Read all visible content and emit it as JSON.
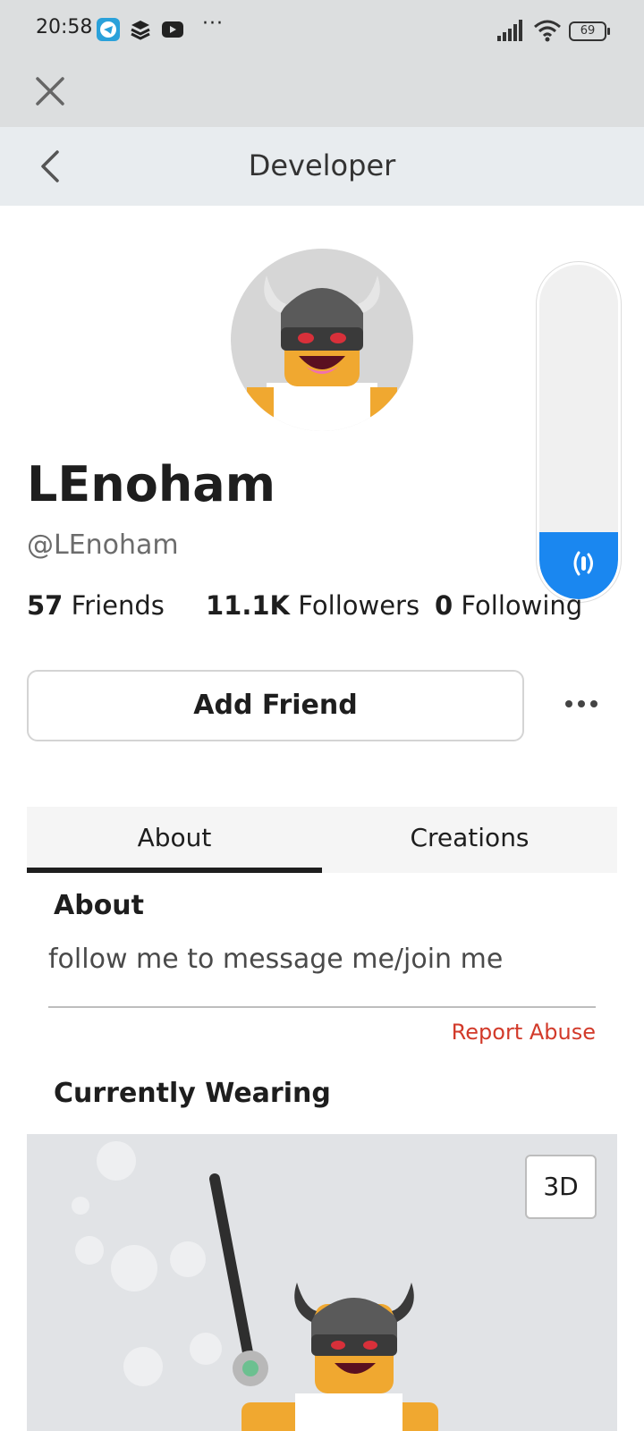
{
  "status_bar": {
    "time": "20:58",
    "battery": "69",
    "app_icons": [
      "telegram-icon",
      "layers-app-icon",
      "youtube-icon"
    ],
    "more": "···"
  },
  "webview": {
    "close_icon": "close-icon"
  },
  "nav": {
    "title": "Developer",
    "back_icon": "chevron-left-icon"
  },
  "profile": {
    "display_name": "LEnoham",
    "username": "@LEnoham",
    "friends_count": "57",
    "friends_label": "Friends",
    "followers_count": "11.1K",
    "followers_label": "Followers",
    "following_count": "0",
    "following_label": "Following"
  },
  "actions": {
    "add_friend": "Add Friend",
    "more_icon": "more-horizontal-icon"
  },
  "voice": {
    "level": 0.2,
    "icon": "voice-chat-icon",
    "accent": "#1a87f0"
  },
  "tabs": [
    {
      "label": "About",
      "active": true
    },
    {
      "label": "Creations",
      "active": false
    }
  ],
  "about": {
    "heading": "About",
    "text": "follow me to message me/join me",
    "report": "Report Abuse"
  },
  "wearing": {
    "heading": "Currently Wearing",
    "view_3d": "3D"
  },
  "colors": {
    "report": "#d23a2a",
    "accent": "#1a87f0"
  }
}
